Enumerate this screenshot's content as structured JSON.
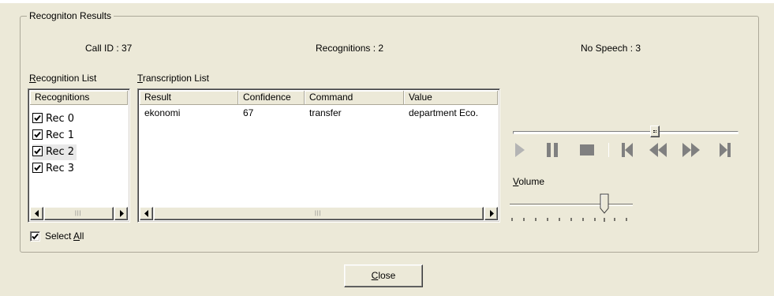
{
  "group": {
    "title": "Recogniton Results"
  },
  "stats": {
    "call_id": "Call ID : 37",
    "recognitions": "Recognitions : 2",
    "no_speech": "No Speech : 3"
  },
  "recognition_list": {
    "label_mnemonic": "R",
    "label_rest": "ecognition List",
    "header": "Recognitions",
    "items": [
      {
        "label": "Rec  0",
        "checked": true
      },
      {
        "label": "Rec  1",
        "checked": true
      },
      {
        "label": "Rec  2",
        "checked": true,
        "selected": true
      },
      {
        "label": "Rec  3",
        "checked": true
      }
    ]
  },
  "transcription_list": {
    "label_mnemonic": "T",
    "label_rest": "ranscription List",
    "columns": [
      "Result",
      "Confidence",
      "Command",
      "Value"
    ],
    "rows": [
      [
        "ekonomi",
        "67",
        "transfer",
        "department Eco."
      ]
    ]
  },
  "select_all": {
    "pre": "Select ",
    "mnemonic": "A",
    "post": "ll",
    "checked": true
  },
  "player": {
    "icons": [
      "play-icon",
      "pause-icon",
      "stop-icon",
      "skip-start-icon",
      "rewind-icon",
      "fast-forward-icon",
      "skip-end-icon"
    ],
    "position_fraction": 0.66
  },
  "volume": {
    "mnemonic": "V",
    "rest": "olume",
    "level_fraction": 0.8
  },
  "close_button": {
    "mnemonic": "C",
    "rest": "lose"
  },
  "colors": {
    "control_face": "#ece9d8",
    "icon_gray": "#808080",
    "frame": "#aca899"
  }
}
